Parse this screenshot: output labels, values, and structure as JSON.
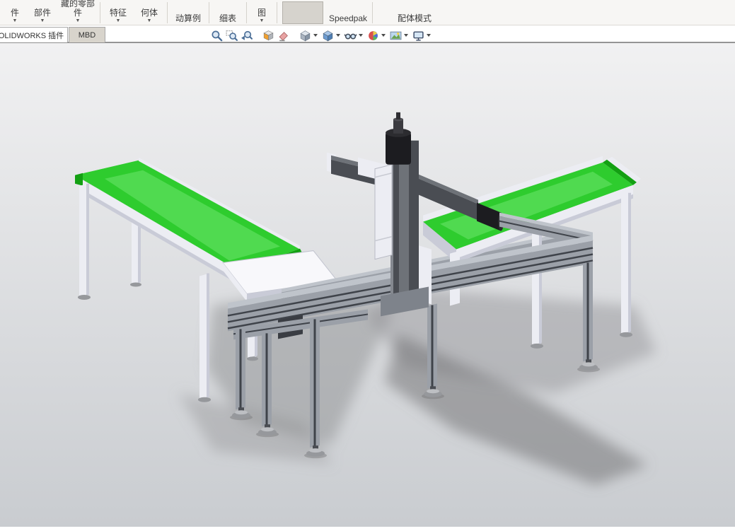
{
  "ribbon": {
    "buttons": [
      {
        "label": "件",
        "dropdown": true
      },
      {
        "label": "部件",
        "dropdown": true
      },
      {
        "label": "藏的零部件",
        "dropdown": true
      },
      {
        "label": "特征",
        "dropdown": true
      },
      {
        "label": "何体",
        "dropdown": true
      },
      {
        "label": "动算例",
        "dropdown": false
      },
      {
        "label": "细表",
        "dropdown": false
      },
      {
        "label": "图",
        "dropdown": true
      },
      {
        "label": "Speedpak",
        "dropdown": false
      },
      {
        "label": "配体模式",
        "dropdown": false
      }
    ]
  },
  "tabs": {
    "items": [
      {
        "label": "OLIDWORKS 插件",
        "active": false
      },
      {
        "label": "MBD",
        "active": true
      }
    ]
  },
  "headsup": {
    "icons": [
      "zoom-to-fit",
      "zoom-to-area",
      "previous-view",
      "section-view",
      "annotation-view",
      "view-orientation",
      "display-style",
      "hide-show-items",
      "edit-appearance",
      "apply-scene",
      "view-settings"
    ]
  },
  "viewport": {
    "scene": "3D assembly: two green belt conveyors with a gantry pick-and-place robot on an aluminium extrusion frame",
    "colors": {
      "bg_top": "#f1f1f2",
      "bg_bottom": "#c9ccd0",
      "belt_green": "#2ecc2e",
      "belt_highlight": "#72e872",
      "belt_dark": "#13a013",
      "frame_white": "#ecedf3",
      "frame_shade": "#c9cbd7",
      "table_white": "#f8f8fb",
      "extrusion_gray": "#9ba0a8",
      "extrusion_highlight": "#bfc4cb",
      "extrusion_dark": "#7e838b",
      "slot_dark": "#3f434a",
      "actuator_dark": "#4a4d53",
      "actuator_light": "#6e7278",
      "motor_black": "#1c1c20",
      "foot_gray": "#96989c",
      "foot_light": "#bdbfc3",
      "shadow_gray": "#8e8f92"
    }
  }
}
